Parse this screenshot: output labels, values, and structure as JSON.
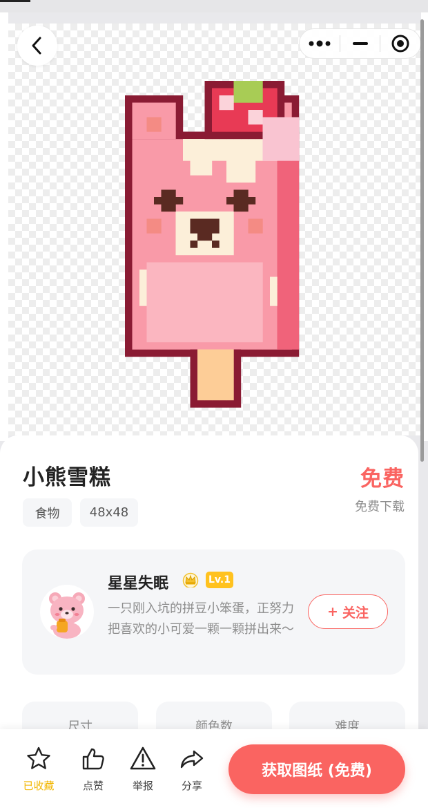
{
  "header": {
    "back_icon": "chevron-left-icon",
    "menu_icon": "more-dots-icon",
    "minimize_icon": "minimize-icon",
    "close_icon": "target-circle-icon"
  },
  "product": {
    "title": "小熊雪糕",
    "price": "免费",
    "price_note": "免费下载",
    "tags": [
      "食物",
      "48x48"
    ]
  },
  "author": {
    "name": "星星失眠",
    "level": "Lv.1",
    "bio": "一只刚入坑的拼豆小笨蛋，正努力把喜欢的小可爱一颗一颗拼出来～",
    "follow_label": "关注",
    "follow_prefix": "+",
    "crown_icon": "crown-icon"
  },
  "stats": {
    "size_label": "尺寸",
    "colors_label": "颜色数",
    "difficulty_label": "难度"
  },
  "bottom_nav": {
    "favorite_label": "已收藏",
    "like_label": "点赞",
    "report_label": "举报",
    "share_label": "分享",
    "get_button_label": "获取图纸 (免费)"
  },
  "colors": {
    "accent": "#fa6461",
    "favorite_active": "#f2b600",
    "level_badge": "#ffc21f"
  }
}
